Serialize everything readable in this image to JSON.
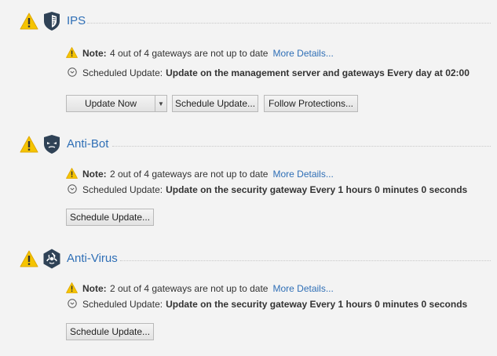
{
  "sections": [
    {
      "title": "IPS",
      "note_label": "Note:",
      "note_text": "4 out of 4 gateways are not up to date",
      "more_link": "More Details...",
      "sched_label": "Scheduled Update:",
      "sched_value": "Update on the management server and gateways  Every day at 02:00",
      "buttons": {
        "update_now": "Update Now",
        "schedule": "Schedule Update...",
        "follow": "Follow Protections..."
      }
    },
    {
      "title": "Anti-Bot",
      "note_label": "Note:",
      "note_text": "2 out of 4 gateways are not up to date",
      "more_link": "More Details...",
      "sched_label": "Scheduled Update:",
      "sched_value": "Update on the security gateway Every 1 hours 0 minutes 0 seconds",
      "buttons": {
        "schedule": "Schedule Update..."
      }
    },
    {
      "title": "Anti-Virus",
      "note_label": "Note:",
      "note_text": "2 out of 4 gateways are not up to date",
      "more_link": "More Details...",
      "sched_label": "Scheduled Update:",
      "sched_value": "Update on the security gateway Every 1 hours 0 minutes 0 seconds",
      "buttons": {
        "schedule": "Schedule Update..."
      }
    }
  ],
  "colors": {
    "accent": "#2f6fb6",
    "warning": "#f5c400",
    "blade": "#2f4256",
    "background": "#f3f3f3"
  },
  "icons": [
    "warning-icon",
    "ips-shield-icon",
    "anti-bot-icon",
    "anti-virus-icon",
    "clock-icon",
    "dropdown-arrow-icon"
  ]
}
